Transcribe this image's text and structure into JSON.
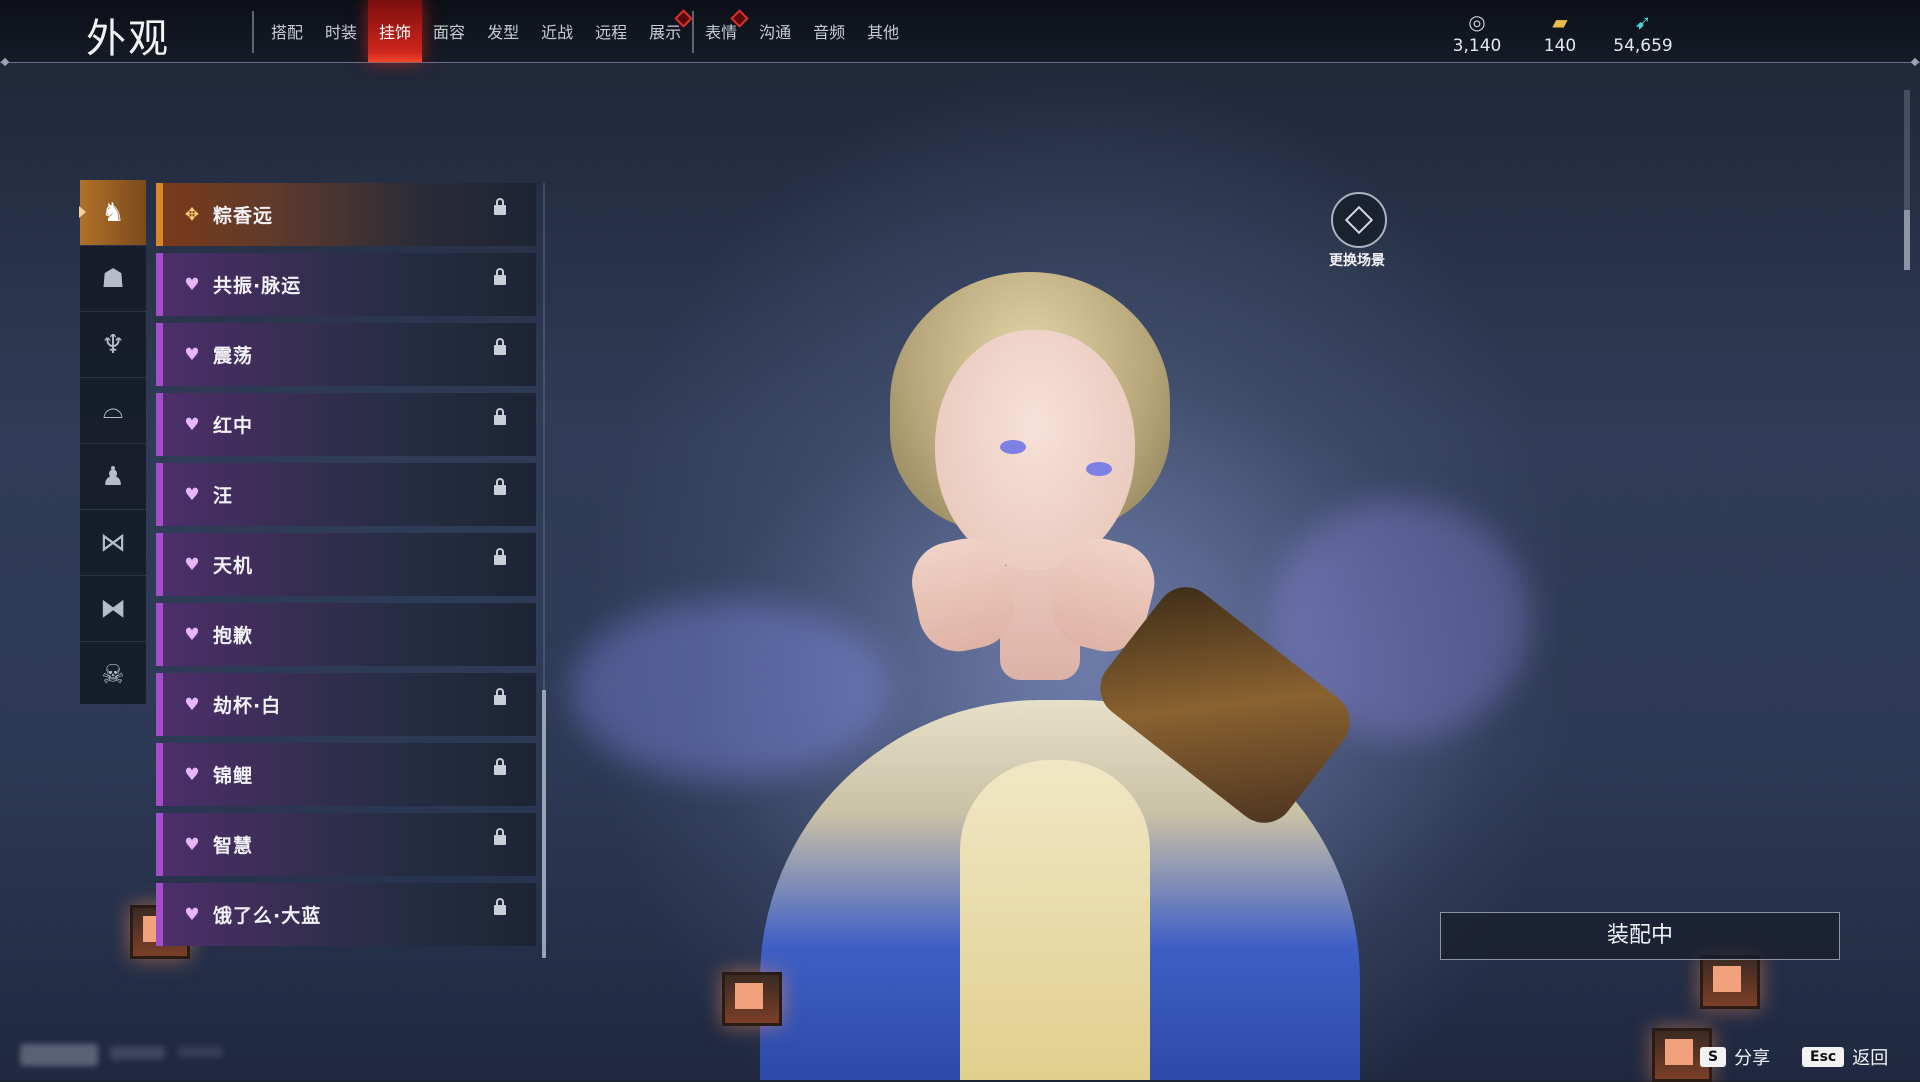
{
  "page_title": "外观",
  "tabs": [
    {
      "label": "搭配"
    },
    {
      "label": "时装"
    },
    {
      "label": "挂饰"
    },
    {
      "label": "面容"
    },
    {
      "label": "发型"
    },
    {
      "label": "近战"
    },
    {
      "label": "远程"
    },
    {
      "label": "展示"
    },
    {
      "label": "表情"
    },
    {
      "label": "沟通"
    },
    {
      "label": "音频"
    },
    {
      "label": "其他"
    }
  ],
  "active_tab": "挂饰",
  "currencies": [
    {
      "icon": "coin-stack-icon",
      "value": "3,140"
    },
    {
      "icon": "ticket-icon",
      "value": "140"
    },
    {
      "icon": "feather-icon",
      "value": "54,659"
    }
  ],
  "categories": [
    {
      "icon": "back-ornament-icon"
    },
    {
      "icon": "head-ornament-icon"
    },
    {
      "icon": "pendant-icon"
    },
    {
      "icon": "face-ornament-icon"
    },
    {
      "icon": "body-ornament-icon"
    },
    {
      "icon": "waist-ornament-icon"
    },
    {
      "icon": "bow-ornament-icon"
    },
    {
      "icon": "mask-icon"
    }
  ],
  "items": [
    {
      "label": "粽香远",
      "rarity": "gold",
      "locked": true
    },
    {
      "label": "共振·脉运",
      "rarity": "purple",
      "locked": true
    },
    {
      "label": "震荡",
      "rarity": "purple",
      "locked": true
    },
    {
      "label": "红中",
      "rarity": "purple",
      "locked": true
    },
    {
      "label": "汪",
      "rarity": "purple",
      "locked": true
    },
    {
      "label": "天机",
      "rarity": "purple",
      "locked": true
    },
    {
      "label": "抱歉",
      "rarity": "purple",
      "locked": false
    },
    {
      "label": "劫杯·白",
      "rarity": "purple",
      "locked": true
    },
    {
      "label": "锦鲤",
      "rarity": "purple",
      "locked": true
    },
    {
      "label": "智慧",
      "rarity": "purple",
      "locked": true
    },
    {
      "label": "饿了么·大蓝",
      "rarity": "purple",
      "locked": true
    }
  ],
  "scene_button": {
    "label": "更换场景",
    "icon": "cube-icon"
  },
  "status_label": "装配中",
  "footer": {
    "share": {
      "key": "S",
      "label": "分享"
    },
    "back": {
      "key": "Esc",
      "label": "返回"
    }
  },
  "colors": {
    "accent_red": "#d0261c",
    "gold": "#d7892a",
    "purple": "#a24fc9"
  }
}
